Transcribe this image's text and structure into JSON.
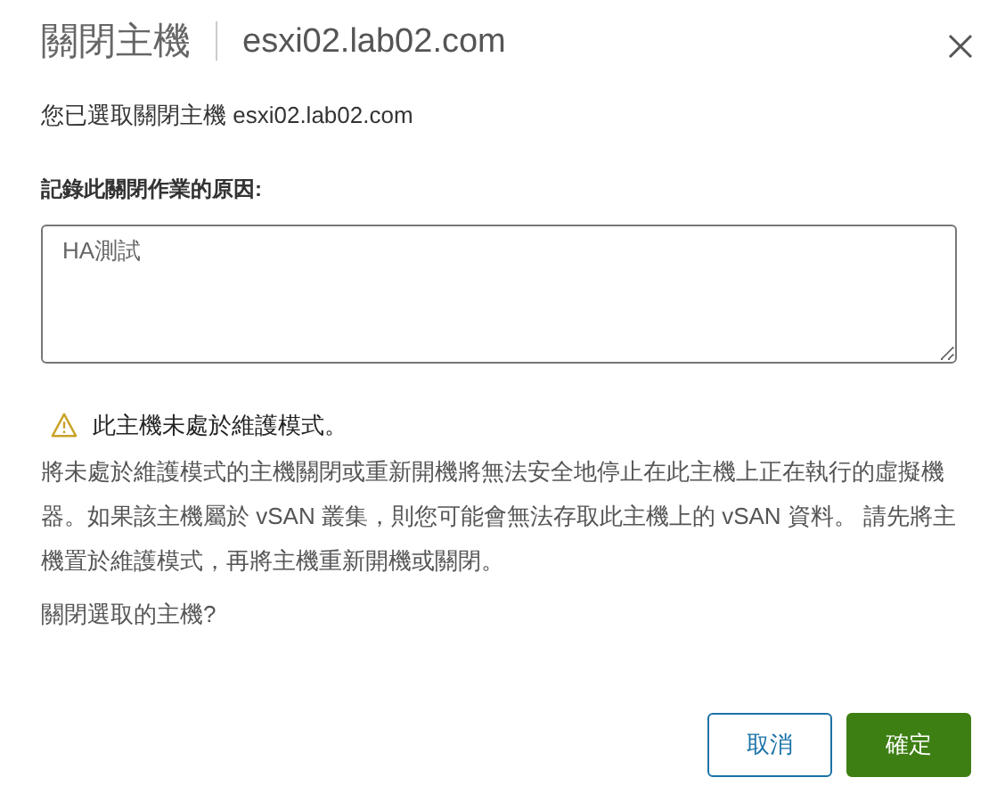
{
  "dialog": {
    "title": "關閉主機",
    "subtitle": "esxi02.lab02.com"
  },
  "intro": "您已選取關閉主機 esxi02.lab02.com",
  "reason": {
    "label": "記錄此關閉作業的原因:",
    "value": "HA測試"
  },
  "warning": {
    "title": "此主機未處於維護模式。",
    "body": "將未處於維護模式的主機關閉或重新開機將無法安全地停止在此主機上正在執行的虛擬機器。如果該主機屬於 vSAN 叢集，則您可能會無法存取此主機上的 vSAN 資料。 請先將主機置於維護模式，再將主機重新開機或關閉。"
  },
  "question": "關閉選取的主機?",
  "buttons": [
    {
      "label": "取消",
      "kind": "secondary"
    },
    {
      "label": "確定",
      "kind": "primary"
    }
  ]
}
